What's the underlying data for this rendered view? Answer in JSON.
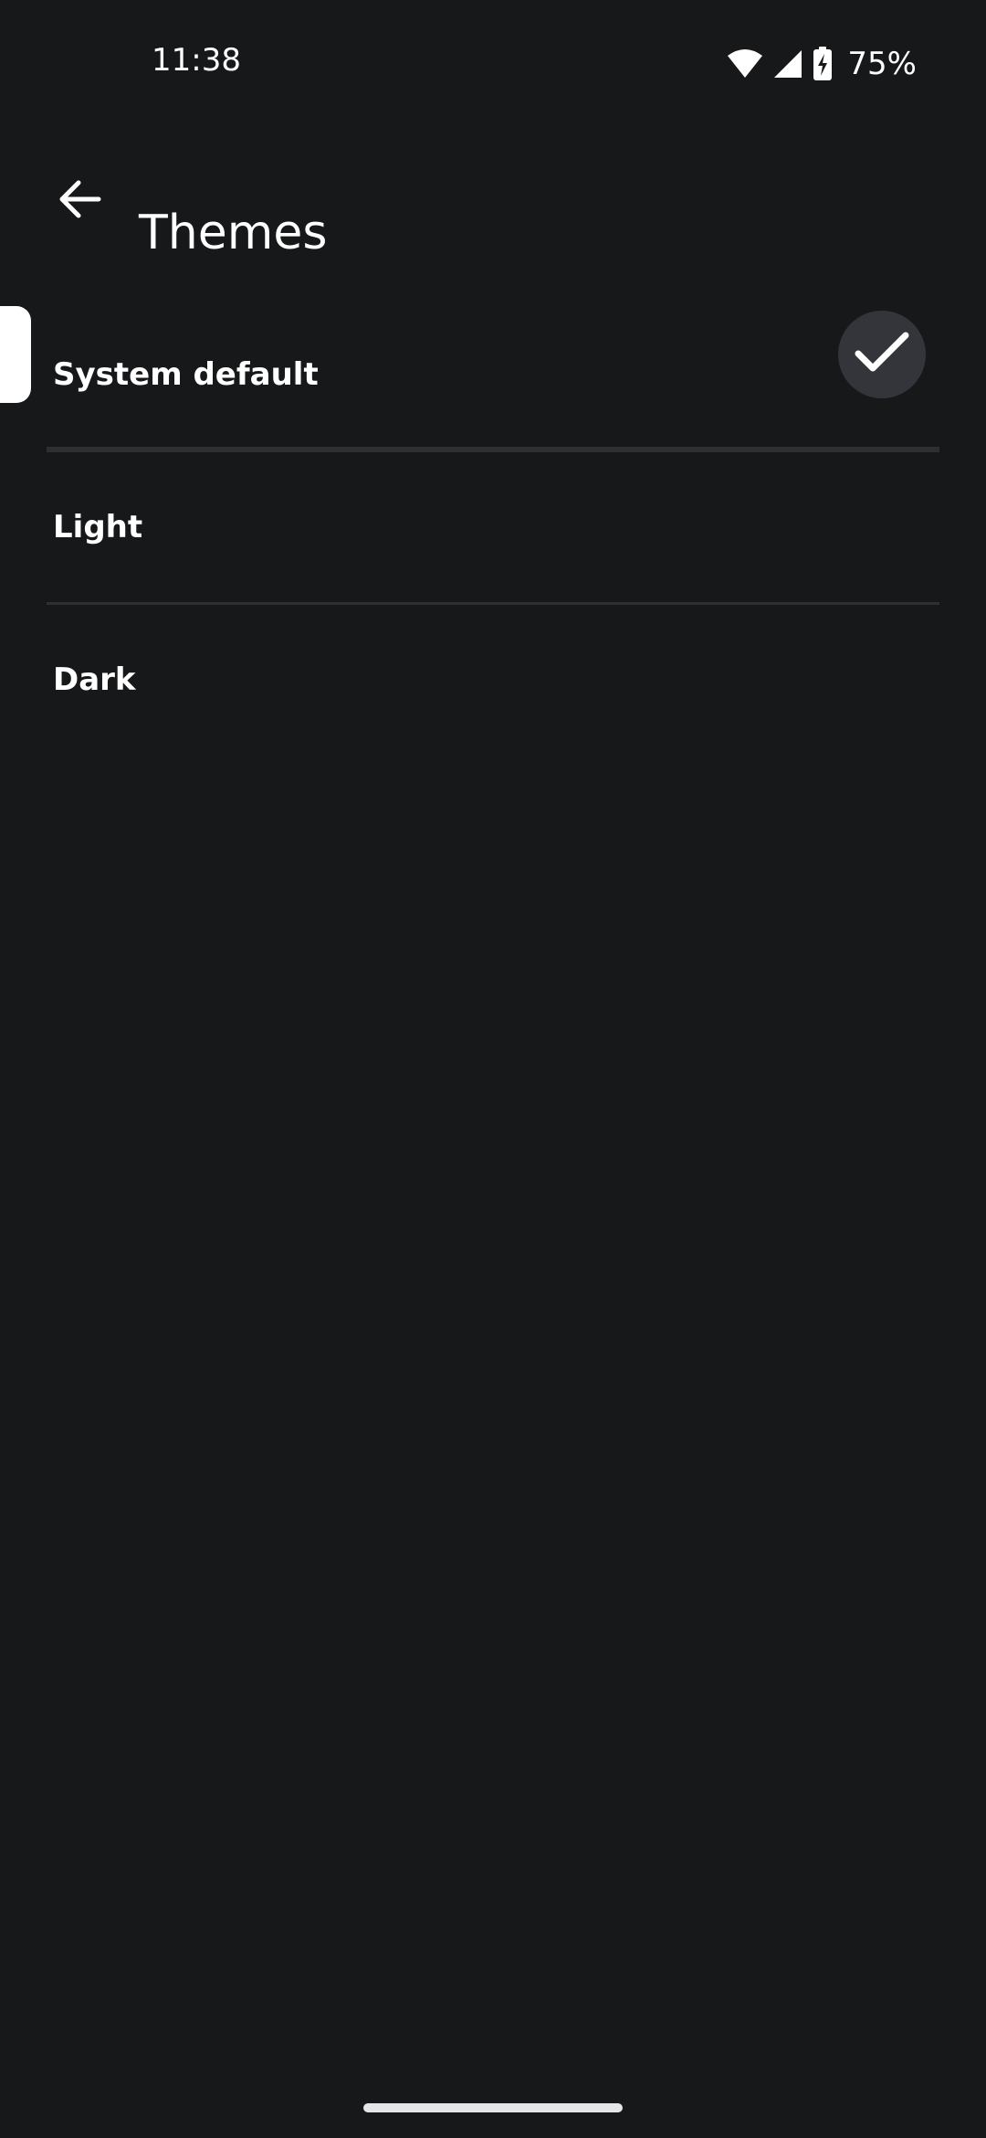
{
  "status_bar": {
    "time": "11:38",
    "battery_percent": "75%",
    "icons": [
      "wifi-icon",
      "cellular-signal-icon",
      "battery-charging-icon"
    ]
  },
  "app_bar": {
    "title": "Themes",
    "back_icon": "arrow-left-icon"
  },
  "theme_options": [
    {
      "label": "System default",
      "selected": true
    },
    {
      "label": "Light",
      "selected": false
    },
    {
      "label": "Dark",
      "selected": false
    }
  ],
  "colors": {
    "background": "#17181a",
    "divider": "#2e2f33",
    "check_circle": "#33353a",
    "text": "#ffffff"
  }
}
